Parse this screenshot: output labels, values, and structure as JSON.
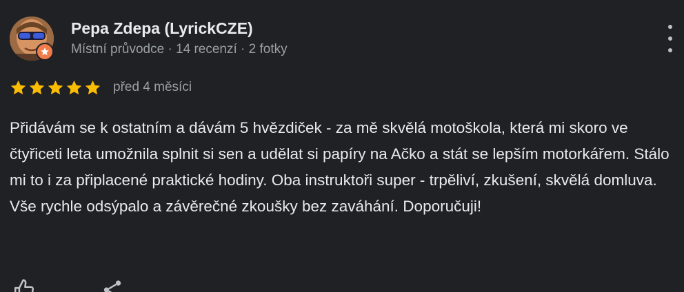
{
  "review": {
    "author_name": "Pepa Zdepa (LyrickCZE)",
    "author_meta": "Místní průvodce · 14 recenzí · 2 fotky",
    "rating": 5,
    "rating_max": 5,
    "date": "před 4 měsíci",
    "text": "Přidávám se k ostatním a dávám 5 hvězdiček - za mě skvělá motoškola, která mi skoro ve čtyřiceti leta umožnila splnit si sen a udělat si papíry na Ačko a stát se lepším motorkářem. Stálo mi to i za připlacené praktické hodiny. Oba instruktoři super - trpěliví, zkušení, skvělá domluva. Vše rychle odsýpalo a závěrečné zkoušky bez zaváhání. Doporučuji!"
  },
  "icons": {
    "more": "more-vert-icon",
    "star": "star-icon",
    "badge": "local-guide-badge-icon",
    "like": "thumb-up-icon",
    "share": "share-icon"
  },
  "colors": {
    "background": "#202124",
    "star": "#fbbc04",
    "badge": "#f17c4b",
    "text_primary": "#e8eaed",
    "text_secondary": "#9aa0a6"
  }
}
